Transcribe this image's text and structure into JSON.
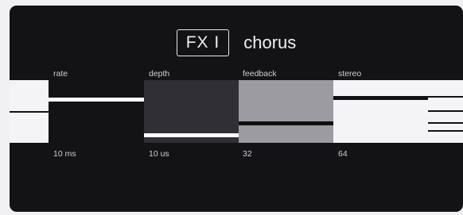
{
  "header": {
    "fx_label": "FX I",
    "effect_name": "chorus"
  },
  "params": [
    {
      "label": "rate",
      "value_text": "10 ms",
      "level": 0.45
    },
    {
      "label": "depth",
      "value_text": "10 us",
      "level": 0.14
    },
    {
      "label": "feedback",
      "value_text": "32",
      "level": 0.38
    },
    {
      "label": "stereo",
      "value_text": "64",
      "level": 0.72
    }
  ],
  "colors": {
    "panel": "#131214",
    "text": "#cfcfd4",
    "depth_fill": "#2f2f35",
    "feedback_fill": "#9b9ba0",
    "stereo_fill": "#f4f3f5"
  }
}
